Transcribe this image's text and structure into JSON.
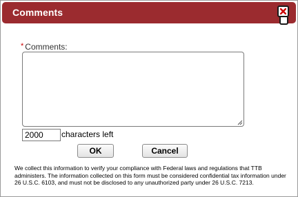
{
  "dialog": {
    "title": "Comments",
    "close_icon": "close-icon",
    "accent_color": "#9b2b2f",
    "close_color": "#cc0000"
  },
  "form": {
    "required_marker": "*",
    "comments_label": "Comments:",
    "comments_value": "",
    "remaining_chars": "2000",
    "remaining_label": "characters left"
  },
  "buttons": {
    "ok_label": "OK",
    "cancel_label": "Cancel"
  },
  "disclaimer": "We collect this information to verify your compliance with Federal laws and regulations that TTB administers. The information collected on this form must be considered confidential tax information under 26 U.S.C. 6103, and must not be disclosed to any unauthorized party under 26 U.S.C. 7213."
}
